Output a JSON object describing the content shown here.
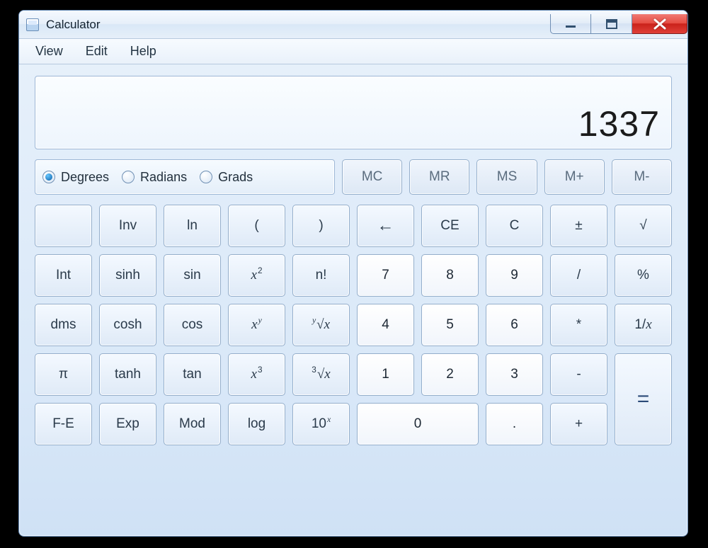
{
  "window": {
    "title": "Calculator"
  },
  "menu": {
    "view": "View",
    "edit": "Edit",
    "help": "Help"
  },
  "display": {
    "value": "1337"
  },
  "mode": {
    "degrees": "Degrees",
    "radians": "Radians",
    "grads": "Grads",
    "selected": "degrees"
  },
  "memory": {
    "mc": "MC",
    "mr": "MR",
    "ms": "MS",
    "mplus": "M+",
    "mminus": "M-"
  },
  "keys": {
    "blank": "",
    "inv": "Inv",
    "ln": "ln",
    "lparen": "(",
    "rparen": ")",
    "back": "←",
    "ce": "CE",
    "c": "C",
    "pm": "±",
    "sqrt": "√",
    "int": "Int",
    "sinh": "sinh",
    "sin": "sin",
    "x2_base": "x",
    "x2_exp": "2",
    "fact": "n!",
    "d7": "7",
    "d8": "8",
    "d9": "9",
    "div": "/",
    "pct": "%",
    "dms": "dms",
    "cosh": "cosh",
    "cos": "cos",
    "xy_base": "x",
    "xy_exp": "y",
    "yroot_pre": "y",
    "yroot_body": "√x",
    "d4": "4",
    "d5": "5",
    "d6": "6",
    "mul": "*",
    "recip_pre": "1/",
    "recip_x": "x",
    "pi": "π",
    "tanh": "tanh",
    "tan": "tan",
    "x3_base": "x",
    "x3_exp": "3",
    "cuberoot_pre": "3",
    "cuberoot_body": "√x",
    "d1": "1",
    "d2": "2",
    "d3": "3",
    "sub": "-",
    "eq": "=",
    "fe": "F-E",
    "exp": "Exp",
    "mod": "Mod",
    "log": "log",
    "tenx_base": "10",
    "tenx_exp": "x",
    "d0": "0",
    "dot": ".",
    "add": "+"
  }
}
